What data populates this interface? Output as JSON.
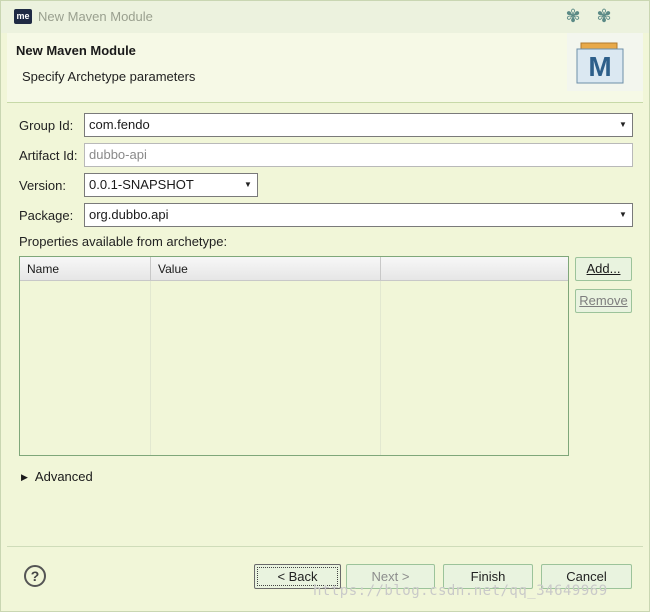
{
  "window": {
    "icon_text": "me",
    "title": "New Maven Module",
    "controls": [
      "pin-icon",
      "pin-icon"
    ]
  },
  "header": {
    "title": "New Maven Module",
    "subtitle": "Specify Archetype parameters",
    "logo_letter": "M"
  },
  "form": {
    "group_id": {
      "label": "Group Id:",
      "value": "com.fendo"
    },
    "artifact_id": {
      "label": "Artifact Id:",
      "value": "dubbo-api"
    },
    "version": {
      "label": "Version:",
      "value": "0.0.1-SNAPSHOT"
    },
    "package": {
      "label": "Package:",
      "value": "org.dubbo.api"
    }
  },
  "properties": {
    "label": "Properties available from archetype:",
    "columns": [
      "Name",
      "Value"
    ],
    "rows": [],
    "add_label": "Add...",
    "remove_label": "Remove"
  },
  "advanced": {
    "label": "Advanced"
  },
  "footer": {
    "help_icon": "?",
    "back_label": "< Back",
    "next_label": "Next >",
    "finish_label": "Finish",
    "cancel_label": "Cancel"
  },
  "watermark": "https://blog.csdn.net/qq_34649969",
  "colors": {
    "background": "#f1f6d8",
    "accent_border": "#9cc39a"
  }
}
